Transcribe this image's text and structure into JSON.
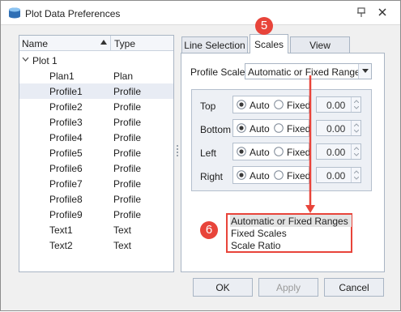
{
  "window": {
    "title": "Plot Data Preferences"
  },
  "tree": {
    "headers": {
      "name": "Name",
      "type": "Type"
    },
    "root": {
      "label": "Plot 1"
    },
    "rows": [
      {
        "name": "Plan1",
        "type": "Plan"
      },
      {
        "name": "Profile1",
        "type": "Profile"
      },
      {
        "name": "Profile2",
        "type": "Profile"
      },
      {
        "name": "Profile3",
        "type": "Profile"
      },
      {
        "name": "Profile4",
        "type": "Profile"
      },
      {
        "name": "Profile5",
        "type": "Profile"
      },
      {
        "name": "Profile6",
        "type": "Profile"
      },
      {
        "name": "Profile7",
        "type": "Profile"
      },
      {
        "name": "Profile8",
        "type": "Profile"
      },
      {
        "name": "Profile9",
        "type": "Profile"
      },
      {
        "name": "Text1",
        "type": "Text"
      },
      {
        "name": "Text2",
        "type": "Text"
      }
    ]
  },
  "tabs": [
    {
      "label": "Line Selection"
    },
    {
      "label": "Scales"
    },
    {
      "label": "View Settings"
    }
  ],
  "scales": {
    "profile_scales_label": "Profile Scales",
    "profile_scales_value": "Automatic or Fixed Ranges",
    "rows": [
      {
        "label": "Top",
        "auto": "Auto",
        "fixed": "Fixed",
        "value": "0.00"
      },
      {
        "label": "Bottom",
        "auto": "Auto",
        "fixed": "Fixed",
        "value": "0.00"
      },
      {
        "label": "Left",
        "auto": "Auto",
        "fixed": "Fixed",
        "value": "0.00"
      },
      {
        "label": "Right",
        "auto": "Auto",
        "fixed": "Fixed",
        "value": "0.00"
      }
    ],
    "dropdown_options": [
      "Automatic or Fixed Ranges",
      "Fixed Scales",
      "Scale Ratio"
    ]
  },
  "callouts": {
    "step5": "5",
    "step6": "6"
  },
  "buttons": {
    "ok": "OK",
    "apply": "Apply",
    "cancel": "Cancel"
  },
  "colors": {
    "callout": "#e8443a",
    "selection": "#e8ecf4",
    "border": "#a9b5c4"
  }
}
